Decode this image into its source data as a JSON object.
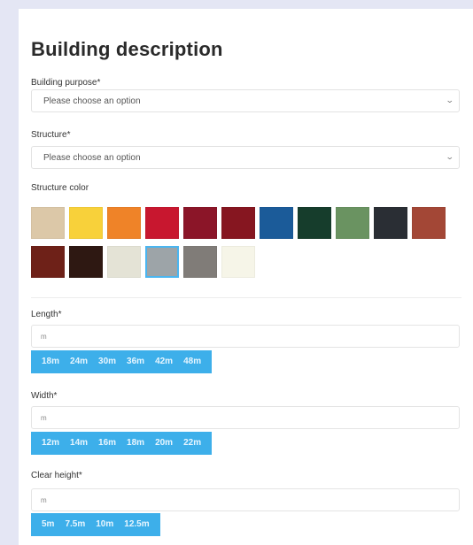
{
  "form": {
    "title": "Building description",
    "purpose": {
      "label": "Building purpose*",
      "value": "Please choose an option"
    },
    "structure": {
      "label": "Structure*",
      "value": "Please choose an option"
    },
    "color": {
      "label": "Structure color",
      "swatches": [
        "#dcc8a8",
        "#f8d13a",
        "#ef8328",
        "#c8172f",
        "#8b1528",
        "#861620",
        "#1b5b99",
        "#163d2c",
        "#6a9361",
        "#2a2e34",
        "#a34736",
        "#6e2118",
        "#2e1812",
        "#e4e3d6",
        "#9da4a8",
        "#807c78",
        "#f6f5e8"
      ],
      "selected_index": 14
    },
    "length": {
      "label": "Length*",
      "unit": "m",
      "options": [
        "18m",
        "24m",
        "30m",
        "36m",
        "42m",
        "48m"
      ]
    },
    "width": {
      "label": "Width*",
      "unit": "m",
      "options": [
        "12m",
        "14m",
        "16m",
        "18m",
        "20m",
        "22m"
      ]
    },
    "clear_height": {
      "label": "Clear height*",
      "unit": "m",
      "options": [
        "5m",
        "7.5m",
        "10m",
        "12.5m"
      ]
    }
  }
}
